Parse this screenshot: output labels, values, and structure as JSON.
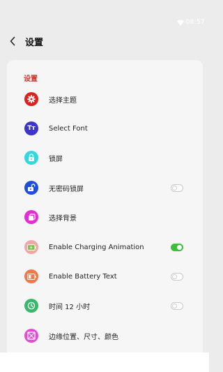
{
  "status_bar": {
    "time": "08:57"
  },
  "header": {
    "title": "设置"
  },
  "section": {
    "title": "设置"
  },
  "colors": {
    "accent_red": "#d0322d",
    "toggle_on": "#3dbf3b"
  },
  "items": [
    {
      "label": "选择主题",
      "icon": "gear-icon",
      "icon_color": "#e02020",
      "toggle": null
    },
    {
      "label": "Select Font",
      "icon": "font-icon",
      "icon_color": "#3b35c9",
      "toggle": null
    },
    {
      "label": "锁屏",
      "icon": "lock-icon",
      "icon_color": "#30d8e0",
      "toggle": null
    },
    {
      "label": "无密码锁屏",
      "icon": "unlock-icon",
      "icon_color": "#1f4fd6",
      "toggle": "off"
    },
    {
      "label": "选择背景",
      "icon": "copy-icon",
      "icon_color": "#e12fd4",
      "toggle": null
    },
    {
      "label": "Enable Charging Animation",
      "icon": "battery-charging-icon",
      "icon_color": "#f0a7a5",
      "toggle": "on"
    },
    {
      "label": "Enable Battery Text",
      "icon": "battery-icon",
      "icon_color": "#ee7a4a",
      "toggle": "off"
    },
    {
      "label": "时间 12 小时",
      "icon": "clock-icon",
      "icon_color": "#38b86b",
      "toggle": "off"
    },
    {
      "label": "边缘位置、尺寸、颜色",
      "icon": "frame-icon",
      "icon_color": "#e34bd2",
      "toggle": null
    }
  ],
  "icon_glyphs": {
    "font": "Tт"
  }
}
